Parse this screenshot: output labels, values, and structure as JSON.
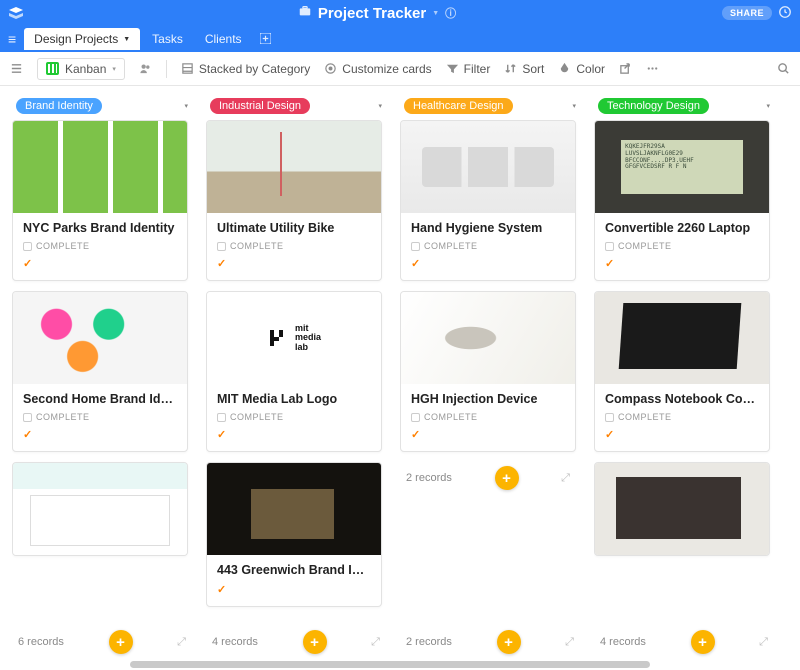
{
  "header": {
    "title": "Project Tracker",
    "share_label": "SHARE"
  },
  "tabs": {
    "items": [
      {
        "label": "Design Projects",
        "active": true,
        "has_dropdown": true
      },
      {
        "label": "Tasks",
        "active": false
      },
      {
        "label": "Clients",
        "active": false
      }
    ]
  },
  "toolbar": {
    "view_label": "Kanban",
    "stacked_label": "Stacked by Category",
    "customize_label": "Customize cards",
    "filter_label": "Filter",
    "sort_label": "Sort",
    "color_label": "Color"
  },
  "columns": [
    {
      "name": "Brand Identity",
      "color": "#4aa3ff",
      "footer_count": "6 records",
      "cards": [
        {
          "title": "NYC Parks Brand Identity",
          "status": "COMPLETE",
          "img": "img-parks"
        },
        {
          "title": "Second Home Brand Iden…",
          "status": "COMPLETE",
          "img": "img-home"
        },
        {
          "title": "",
          "status": "",
          "img": "img-wire",
          "title_hidden": true
        }
      ]
    },
    {
      "name": "Industrial Design",
      "color": "#e73c5c",
      "footer_count": "4 records",
      "cards": [
        {
          "title": "Ultimate Utility Bike",
          "status": "COMPLETE",
          "img": "img-bike"
        },
        {
          "title": "MIT Media Lab Logo",
          "status": "COMPLETE",
          "img": "img-mit"
        },
        {
          "title": "443 Greenwich Brand Ide…",
          "status": "",
          "img": "img-books"
        }
      ]
    },
    {
      "name": "Healthcare Design",
      "color": "#fca919",
      "footer_count": "2 records",
      "inline_footer": true,
      "cards": [
        {
          "title": "Hand Hygiene System",
          "status": "COMPLETE",
          "img": "img-hygiene"
        },
        {
          "title": "HGH Injection Device",
          "status": "COMPLETE",
          "img": "img-hgh"
        }
      ]
    },
    {
      "name": "Technology Design",
      "color": "#20c933",
      "footer_count": "4 records",
      "cards": [
        {
          "title": "Convertible 2260 Laptop",
          "status": "COMPLETE",
          "img": "img-laptop1"
        },
        {
          "title": "Compass Notebook Comp…",
          "status": "COMPLETE",
          "img": "img-laptop2"
        },
        {
          "title": "",
          "status": "",
          "img": "img-tablet",
          "title_hidden": true
        }
      ]
    }
  ]
}
